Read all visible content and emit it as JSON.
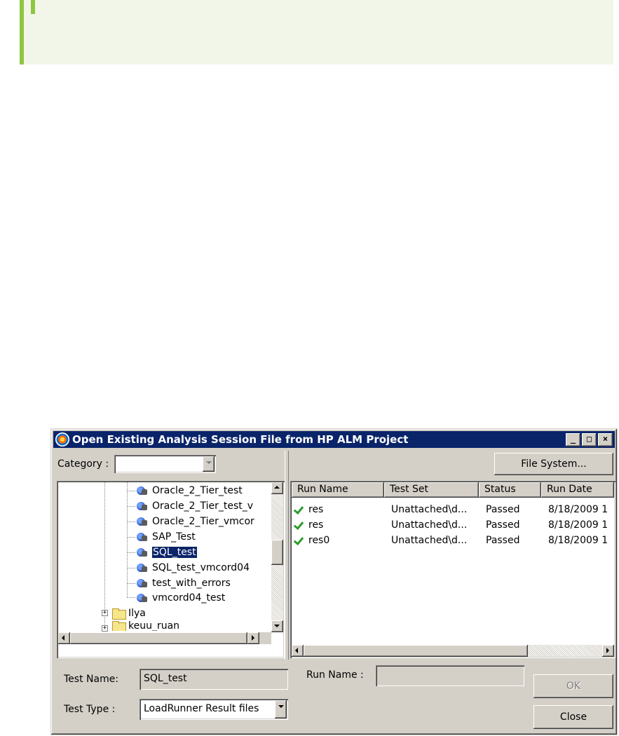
{
  "dialog": {
    "title": "Open Existing Analysis Session File from HP ALM Project",
    "titlebar_buttons": {
      "minimize": "_",
      "maximize": "□",
      "close": "×"
    },
    "category_label": "Category :",
    "category_value": "",
    "file_system_button": "File System...",
    "tree": {
      "items": [
        {
          "label": "Oracle_2_Tier_test",
          "type": "test"
        },
        {
          "label": "Oracle_2_Tier_test_v",
          "type": "test"
        },
        {
          "label": "Oracle_2_Tier_vmcor",
          "type": "test"
        },
        {
          "label": "SAP_Test",
          "type": "test"
        },
        {
          "label": "SQL_test",
          "type": "test",
          "selected": true
        },
        {
          "label": "SQL_test_vmcord04",
          "type": "test"
        },
        {
          "label": "test_with_errors",
          "type": "test"
        },
        {
          "label": "vmcord04_test",
          "type": "test"
        },
        {
          "label": "Ilya",
          "type": "folder",
          "expander": "+"
        },
        {
          "label": "keuu_ruan",
          "type": "folder",
          "expander": "+"
        }
      ]
    },
    "runs_table": {
      "columns": [
        "Run Name",
        "Test Set",
        "Status",
        "Run Date"
      ],
      "rows": [
        {
          "run_name": "res",
          "test_set": "Unattached\\d...",
          "status": "Passed",
          "run_date": "8/18/2009 1"
        },
        {
          "run_name": "res",
          "test_set": "Unattached\\d...",
          "status": "Passed",
          "run_date": "8/18/2009 1"
        },
        {
          "run_name": "res0",
          "test_set": "Unattached\\d...",
          "status": "Passed",
          "run_date": "8/18/2009 1"
        }
      ]
    },
    "test_name_label": "Test Name:",
    "test_name_value": "SQL_test",
    "run_name_label": "Run Name :",
    "run_name_value": "",
    "test_type_label": "Test Type :",
    "test_type_value": "LoadRunner Result files",
    "ok_button": "OK",
    "close_button": "Close"
  },
  "colors": {
    "titlebar": "#0a246a",
    "window_face": "#d4d0c8",
    "note_accent": "#8ec641",
    "note_bg": "#f1f6e8",
    "check": "#2a9d2a"
  }
}
